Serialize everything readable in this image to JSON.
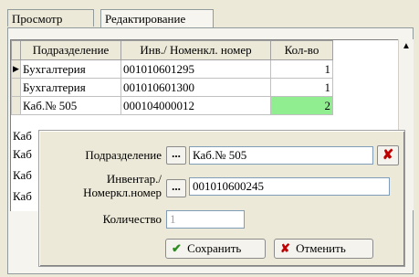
{
  "tabs": [
    {
      "label": "Просмотр"
    },
    {
      "label": "Редактирование"
    }
  ],
  "grid": {
    "columns": [
      "Подразделение",
      "Инв./ Номенкл. номер",
      "Кол-во"
    ],
    "rows": [
      {
        "dept": "Бухгалтерия",
        "inv": "001010601295",
        "qty": "1"
      },
      {
        "dept": "Бухгалтерия",
        "inv": "001010601300",
        "qty": "1"
      },
      {
        "dept": "Каб.№ 505",
        "inv": "000104000012",
        "qty": "2"
      }
    ],
    "hidden_rows_prefix": [
      "Каб",
      "Каб",
      "Каб",
      "Каб"
    ],
    "indicator": "▶"
  },
  "dialog": {
    "dept_label": "Подразделение",
    "dept_value": "Каб.№ 505",
    "inv_label_line1": "Инвентар./",
    "inv_label_line2": "Номеркл.номер",
    "inv_value": "001010600245",
    "qty_label": "Количество",
    "qty_value": "1",
    "browse_label": "...",
    "delete_label": "✘",
    "save_label": "Сохранить",
    "cancel_label": "Отменить",
    "save_icon": "✔",
    "cancel_icon": "✘"
  },
  "colors": {
    "highlight_cell": "#90ee90",
    "delete_red": "#c00000",
    "ok_green": "#2e8b22"
  }
}
